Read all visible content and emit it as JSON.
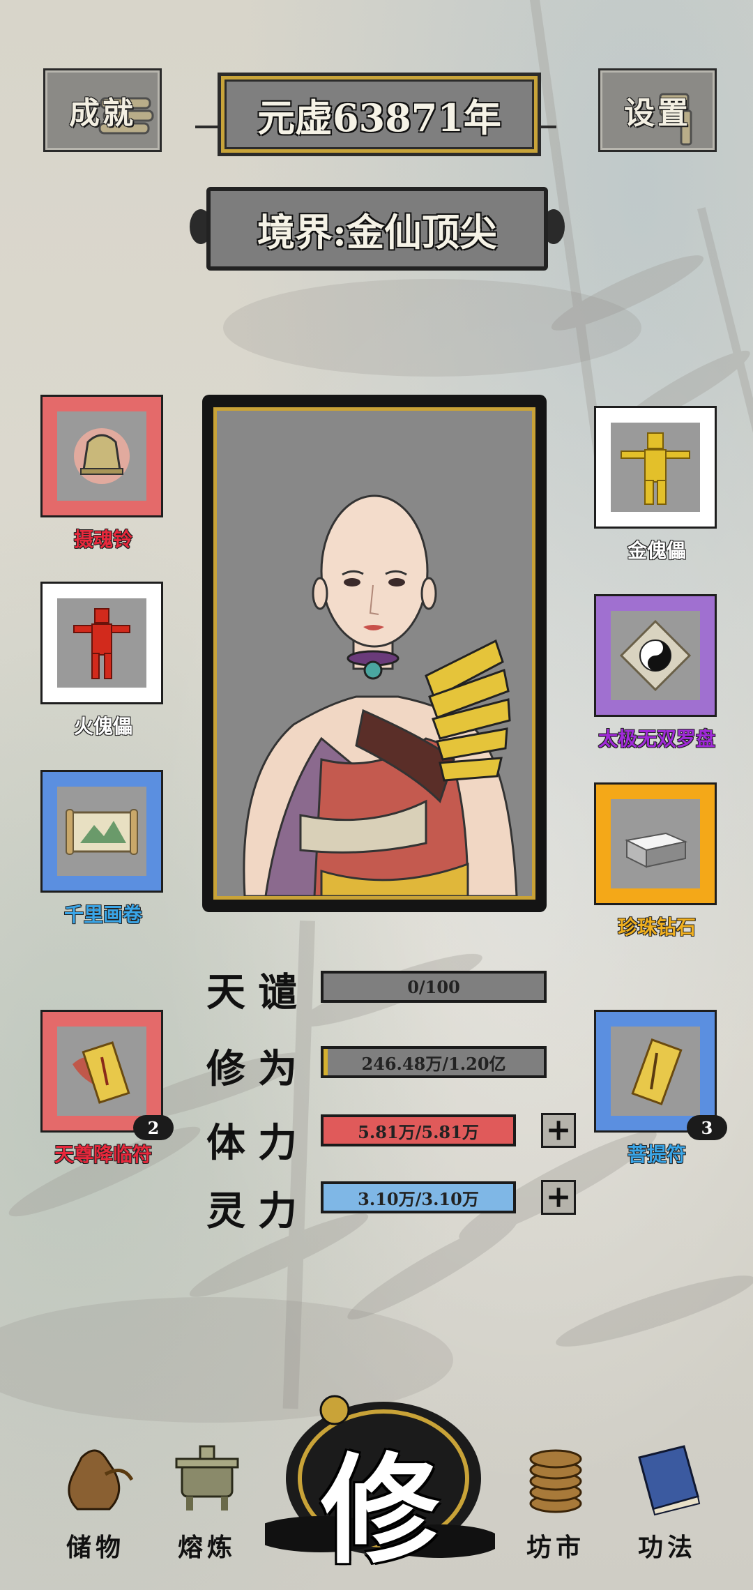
{
  "header": {
    "achievement_label": "成就",
    "settings_label": "设置",
    "year_label": "元虚63871年",
    "realm_label": "境界:金仙顶尖"
  },
  "left_items": [
    {
      "name": "摄魂铃",
      "color": "#e8283c"
    },
    {
      "name": "火傀儡",
      "color": "#ffffff"
    },
    {
      "name": "千里画卷",
      "color": "#3aa6e8"
    },
    {
      "name": "天尊降临符",
      "color": "#e8283c",
      "count": "2"
    }
  ],
  "right_items": [
    {
      "name": "金傀儡",
      "color": "#ffffff"
    },
    {
      "name": "太极无双罗盘",
      "color": "#a02ad8"
    },
    {
      "name": "珍珠钻石",
      "color": "#f0b020"
    },
    {
      "name": "菩提符",
      "color": "#3aa6e8",
      "count": "3"
    }
  ],
  "stats": {
    "tianqian": {
      "label": "天谴",
      "value": "0/100",
      "fill": 0
    },
    "xiuwei": {
      "label": "修为",
      "value": "246.48万/1.20亿",
      "fill": 0.02
    },
    "tili": {
      "label": "体力",
      "value": "5.81万/5.81万",
      "fill": 1,
      "plus": "+"
    },
    "lingli": {
      "label": "灵力",
      "value": "3.10万/3.10万",
      "fill": 1,
      "plus": "+"
    }
  },
  "nav": {
    "storage": "储物",
    "refine": "熔炼",
    "cultivate": "修",
    "market": "坊市",
    "skills": "功法"
  },
  "colors": {
    "red_frame": "#e46a6a",
    "white_frame": "#ffffff",
    "blue_frame": "#5b8fe0",
    "purple_frame": "#a070d0",
    "gold_frame": "#f4a818",
    "hp_bar": "#e05a5a",
    "mp_bar": "#7fb7e6",
    "xiuwei_fill": "#d4b030"
  }
}
